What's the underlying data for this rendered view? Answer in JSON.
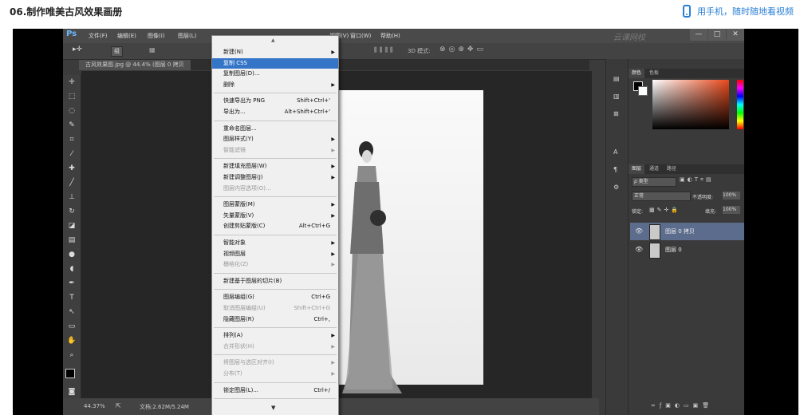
{
  "page": {
    "title": "06.制作唯美古风效果画册",
    "mobile_link": "用手机，随时随地看视频"
  },
  "colors": {
    "accent": "#2a7fd4",
    "menu_highlight": "#3475c8",
    "ps_dark": "#3b3b3b",
    "layer_selected": "#5b6c8c"
  },
  "ps": {
    "logo": "Ps",
    "menubar": [
      "文件(F)",
      "编辑(E)",
      "图像(I)",
      "图层(L)",
      "",
      "",
      "",
      "",
      "视图(V)",
      "窗口(W)",
      "帮助(H)"
    ],
    "window_controls": [
      "—",
      "□",
      "✕"
    ],
    "watermark": "云课网校",
    "options": {
      "zoom_field": "组",
      "mode_3d": "3D 模式:"
    },
    "doc_tab": "古风效果图.jpg @ 44.4% (图层 0 拷贝",
    "status": {
      "zoom": "44.37%",
      "doc": "文档:2.62M/5.24M"
    },
    "panels": {
      "color_tabs": [
        "颜色",
        "色板"
      ],
      "layers_tabs": [
        "图层",
        "通道",
        "路径"
      ],
      "filter_kind": "ρ 类型",
      "blend_mode": "正常",
      "opacity_label": "不透明度:",
      "opacity_value": "100%",
      "lock_label": "锁定:",
      "fill_label": "填充:",
      "fill_value": "100%",
      "layers": [
        {
          "name": "图层 0 拷贝",
          "selected": true
        },
        {
          "name": "图层 0",
          "selected": false
        }
      ]
    }
  },
  "menu": {
    "items": [
      {
        "label": "新建(N)",
        "shortcut": "",
        "submenu": true,
        "state": "normal"
      },
      {
        "label": "复制 CSS",
        "shortcut": "",
        "submenu": false,
        "state": "highlight"
      },
      {
        "label": "复制图层(D)...",
        "shortcut": "",
        "submenu": false,
        "state": "normal"
      },
      {
        "label": "删除",
        "shortcut": "",
        "submenu": true,
        "state": "normal"
      },
      {
        "sep": true
      },
      {
        "label": "快速导出为 PNG",
        "shortcut": "Shift+Ctrl+'",
        "submenu": false,
        "state": "normal"
      },
      {
        "label": "导出为...",
        "shortcut": "Alt+Shift+Ctrl+'",
        "submenu": false,
        "state": "normal"
      },
      {
        "sep": true
      },
      {
        "label": "重命名图层...",
        "shortcut": "",
        "submenu": false,
        "state": "normal"
      },
      {
        "label": "图层样式(Y)",
        "shortcut": "",
        "submenu": true,
        "state": "normal"
      },
      {
        "label": "智能滤镜",
        "shortcut": "",
        "submenu": true,
        "state": "disabled"
      },
      {
        "sep": true
      },
      {
        "label": "新建填充图层(W)",
        "shortcut": "",
        "submenu": true,
        "state": "normal"
      },
      {
        "label": "新建调整图层(J)",
        "shortcut": "",
        "submenu": true,
        "state": "normal"
      },
      {
        "label": "图层内容选项(O)...",
        "shortcut": "",
        "submenu": false,
        "state": "disabled"
      },
      {
        "sep": true
      },
      {
        "label": "图层蒙版(M)",
        "shortcut": "",
        "submenu": true,
        "state": "normal"
      },
      {
        "label": "矢量蒙版(V)",
        "shortcut": "",
        "submenu": true,
        "state": "normal"
      },
      {
        "label": "创建剪贴蒙版(C)",
        "shortcut": "Alt+Ctrl+G",
        "submenu": false,
        "state": "normal"
      },
      {
        "sep": true
      },
      {
        "label": "智能对象",
        "shortcut": "",
        "submenu": true,
        "state": "normal"
      },
      {
        "label": "视频图层",
        "shortcut": "",
        "submenu": true,
        "state": "normal"
      },
      {
        "label": "栅格化(Z)",
        "shortcut": "",
        "submenu": true,
        "state": "disabled"
      },
      {
        "sep": true
      },
      {
        "label": "新建基于图层的切片(B)",
        "shortcut": "",
        "submenu": false,
        "state": "normal"
      },
      {
        "sep": true
      },
      {
        "label": "图层编组(G)",
        "shortcut": "Ctrl+G",
        "submenu": false,
        "state": "normal"
      },
      {
        "label": "取消图层编组(U)",
        "shortcut": "Shift+Ctrl+G",
        "submenu": false,
        "state": "disabled"
      },
      {
        "label": "隐藏图层(R)",
        "shortcut": "Ctrl+,",
        "submenu": false,
        "state": "normal"
      },
      {
        "sep": true
      },
      {
        "label": "排列(A)",
        "shortcut": "",
        "submenu": true,
        "state": "normal"
      },
      {
        "label": "合并形状(H)",
        "shortcut": "",
        "submenu": true,
        "state": "disabled"
      },
      {
        "sep": true
      },
      {
        "label": "将图层与选区对齐(I)",
        "shortcut": "",
        "submenu": true,
        "state": "disabled"
      },
      {
        "label": "分布(T)",
        "shortcut": "",
        "submenu": true,
        "state": "disabled"
      },
      {
        "sep": true
      },
      {
        "label": "锁定图层(L)...",
        "shortcut": "Ctrl+/",
        "submenu": false,
        "state": "normal"
      },
      {
        "sep": true
      }
    ]
  }
}
